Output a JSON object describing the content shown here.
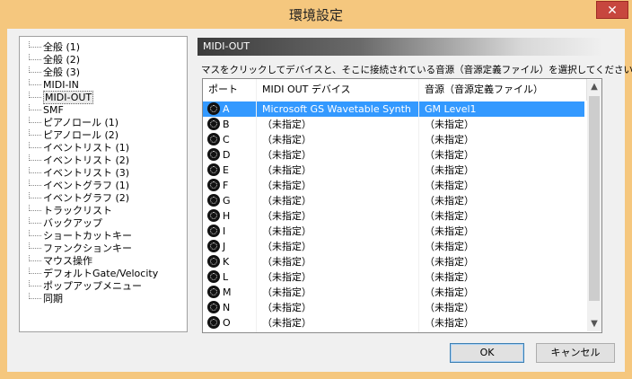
{
  "window": {
    "title": "環境設定",
    "close_label": "✕"
  },
  "tree": {
    "items": [
      "全般 (1)",
      "全般 (2)",
      "全般 (3)",
      "MIDI-IN",
      "MIDI-OUT",
      "SMF",
      "ピアノロール (1)",
      "ピアノロール (2)",
      "イベントリスト (1)",
      "イベントリスト (2)",
      "イベントリスト (3)",
      "イベントグラフ (1)",
      "イベントグラフ (2)",
      "トラックリスト",
      "バックアップ",
      "ショートカットキー",
      "ファンクションキー",
      "マウス操作",
      "デフォルトGate/Velocity",
      "ポップアップメニュー",
      "同期"
    ],
    "selected": "MIDI-OUT"
  },
  "panel": {
    "header": "MIDI-OUT",
    "instruction": "マスをクリックしてデバイスと、そこに接続されている音源（音源定義ファイル）を選択してください。"
  },
  "list": {
    "columns": [
      "ポート",
      "MIDI OUT デバイス",
      "音源（音源定義ファイル）"
    ],
    "rows": [
      {
        "port": "A",
        "device": "Microsoft GS Wavetable Synth",
        "source": "GM Level1",
        "selected": true
      },
      {
        "port": "B",
        "device": "（未指定）",
        "source": "（未指定）"
      },
      {
        "port": "C",
        "device": "（未指定）",
        "source": "（未指定）"
      },
      {
        "port": "D",
        "device": "（未指定）",
        "source": "（未指定）"
      },
      {
        "port": "E",
        "device": "（未指定）",
        "source": "（未指定）"
      },
      {
        "port": "F",
        "device": "（未指定）",
        "source": "（未指定）"
      },
      {
        "port": "G",
        "device": "（未指定）",
        "source": "（未指定）"
      },
      {
        "port": "H",
        "device": "（未指定）",
        "source": "（未指定）"
      },
      {
        "port": "I",
        "device": "（未指定）",
        "source": "（未指定）"
      },
      {
        "port": "J",
        "device": "（未指定）",
        "source": "（未指定）"
      },
      {
        "port": "K",
        "device": "（未指定）",
        "source": "（未指定）"
      },
      {
        "port": "L",
        "device": "（未指定）",
        "source": "（未指定）"
      },
      {
        "port": "M",
        "device": "（未指定）",
        "source": "（未指定）"
      },
      {
        "port": "N",
        "device": "（未指定）",
        "source": "（未指定）"
      },
      {
        "port": "O",
        "device": "（未指定）",
        "source": "（未指定）"
      }
    ],
    "row_icon": "midi-connector-icon"
  },
  "buttons": {
    "ok": "OK",
    "cancel": "キャンセル"
  },
  "colors": {
    "titlebar": "#f5c77e",
    "close": "#c7473e",
    "selection": "#3399ff"
  }
}
